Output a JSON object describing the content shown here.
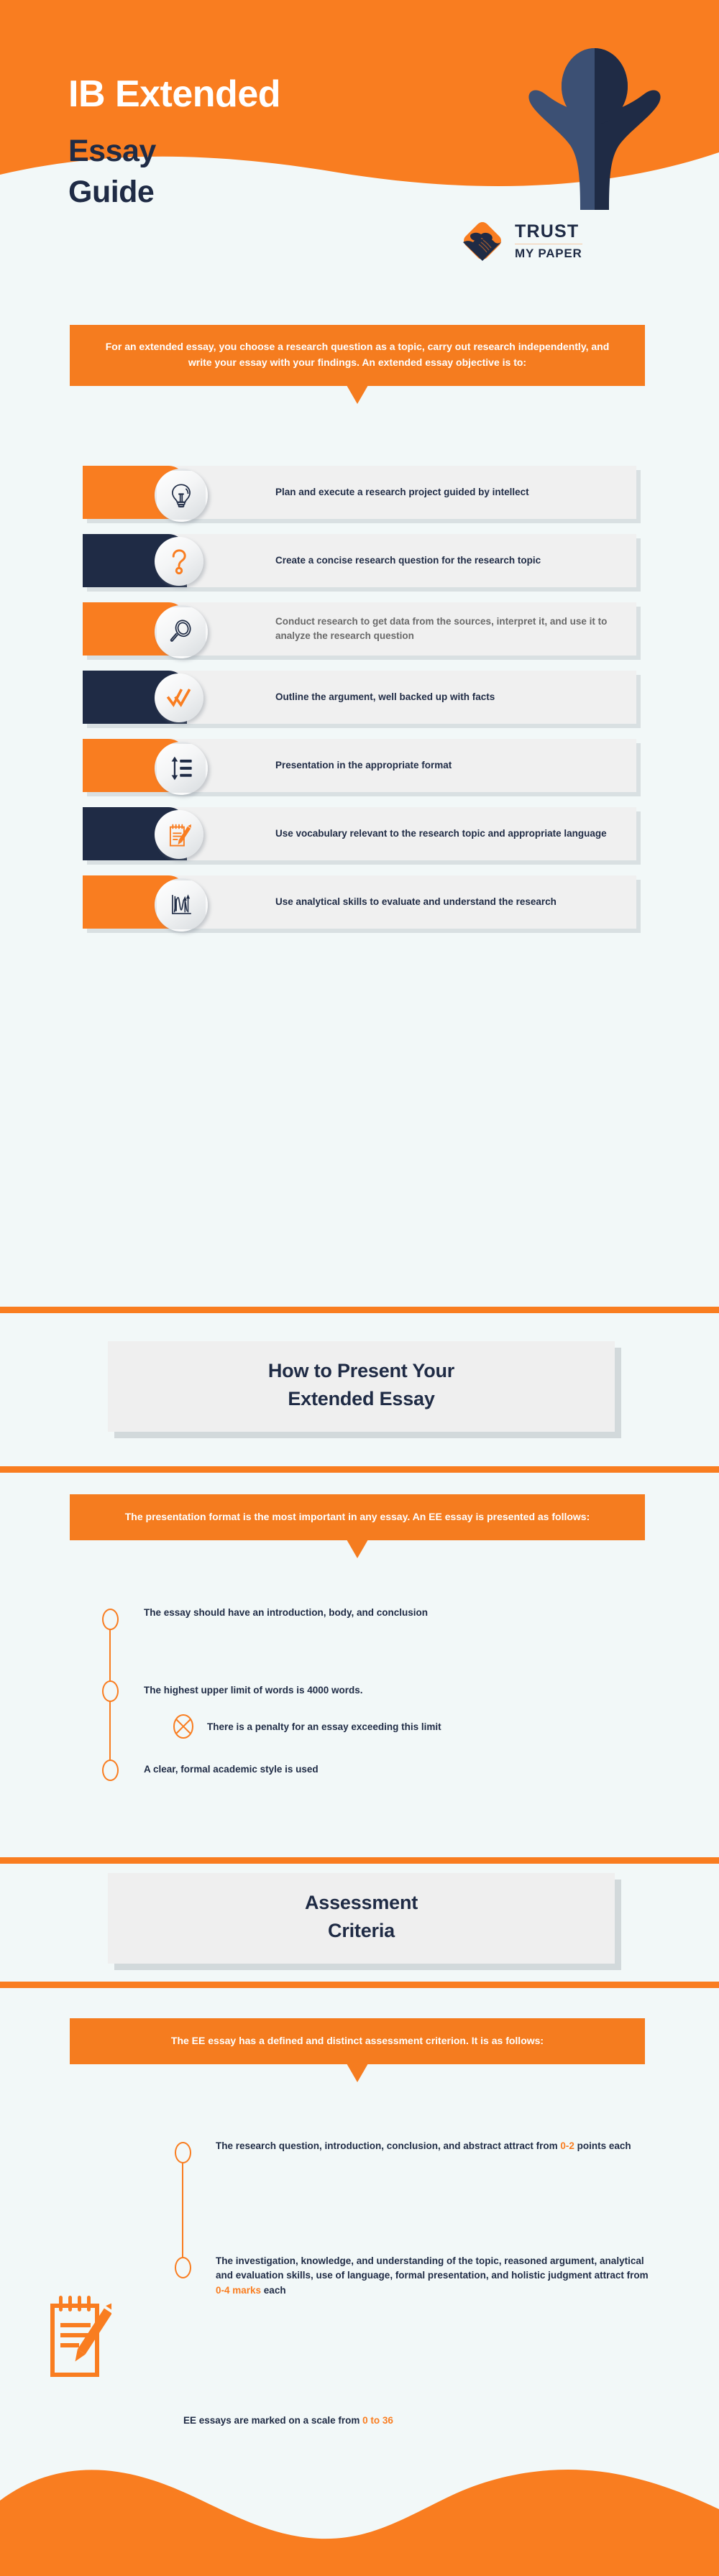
{
  "header": {
    "title_line1": "IB Extended",
    "title_line2": "Essay",
    "title_line3": "Guide",
    "logo_trust": "TRUST",
    "logo_my_paper": "MY PAPER"
  },
  "intro": {
    "text": "For an extended essay, you choose a research question as a topic, carry out research independently, and write your essay with your findings. An extended essay objective is to:"
  },
  "objectives": [
    {
      "icon": "lightbulb-icon",
      "style": "orange",
      "text_color": "navy",
      "text": "Plan and execute a research project guided by intellect"
    },
    {
      "icon": "question-mark-icon",
      "style": "navy",
      "text_color": "navy",
      "text": "Create a concise research question for the research topic"
    },
    {
      "icon": "magnifier-icon",
      "style": "orange",
      "text_color": "gray",
      "text": "Conduct research to get data from the sources, interpret it, and use it to analyze the research question"
    },
    {
      "icon": "double-check-icon",
      "style": "navy",
      "text_color": "navy",
      "text": "Outline the argument, well backed up with facts"
    },
    {
      "icon": "format-list-icon",
      "style": "orange",
      "text_color": "navy",
      "text": "Presentation in the appropriate format"
    },
    {
      "icon": "notepad-pencil-icon",
      "style": "navy",
      "text_color": "navy",
      "text": "Use vocabulary relevant to the research topic and appropriate language"
    },
    {
      "icon": "analytics-chart-icon",
      "style": "orange",
      "text_color": "navy",
      "text": "Use analytical skills to evaluate and understand the research"
    }
  ],
  "presentation_section": {
    "title_line1": "How to Present Your",
    "title_line2": "Extended Essay",
    "banner": "The presentation format is the most important in any essay. An EE essay is presented as follows:",
    "items": [
      {
        "type": "node",
        "text": "The essay should have an introduction, body, and conclusion"
      },
      {
        "type": "node",
        "text": "The highest upper limit of words is 4000 words."
      },
      {
        "type": "cross",
        "text": "There is a penalty for an essay exceeding this limit"
      },
      {
        "type": "node",
        "text": "A clear, formal academic style is used"
      }
    ]
  },
  "assessment_section": {
    "title_line1": "Assessment",
    "title_line2": "Criteria",
    "banner": "The EE essay has a defined and distinct assessment criterion. It is as follows:",
    "items": [
      {
        "type": "node",
        "pre": "The research question, introduction, conclusion, and abstract attract from ",
        "highlight": "0-2",
        "post": " points each"
      },
      {
        "type": "node",
        "pre": "The investigation, knowledge, and understanding of the topic, reasoned argument, analytical and evaluation skills, use of language, formal presentation, and holistic judgment attract from ",
        "highlight": "0-4 marks",
        "post": " each"
      }
    ],
    "footer_pre": "EE essays are marked on a scale from ",
    "footer_highlight": "0 to 36",
    "footer_post": ""
  },
  "colors": {
    "orange": "#f97d20",
    "orange_banner": "#f57c1f",
    "navy": "#1f2b45",
    "navy_light": "#3c5074",
    "background": "#f2f8f8",
    "card_body": "#f0f0f0",
    "gray_text": "#6a6a6a"
  }
}
